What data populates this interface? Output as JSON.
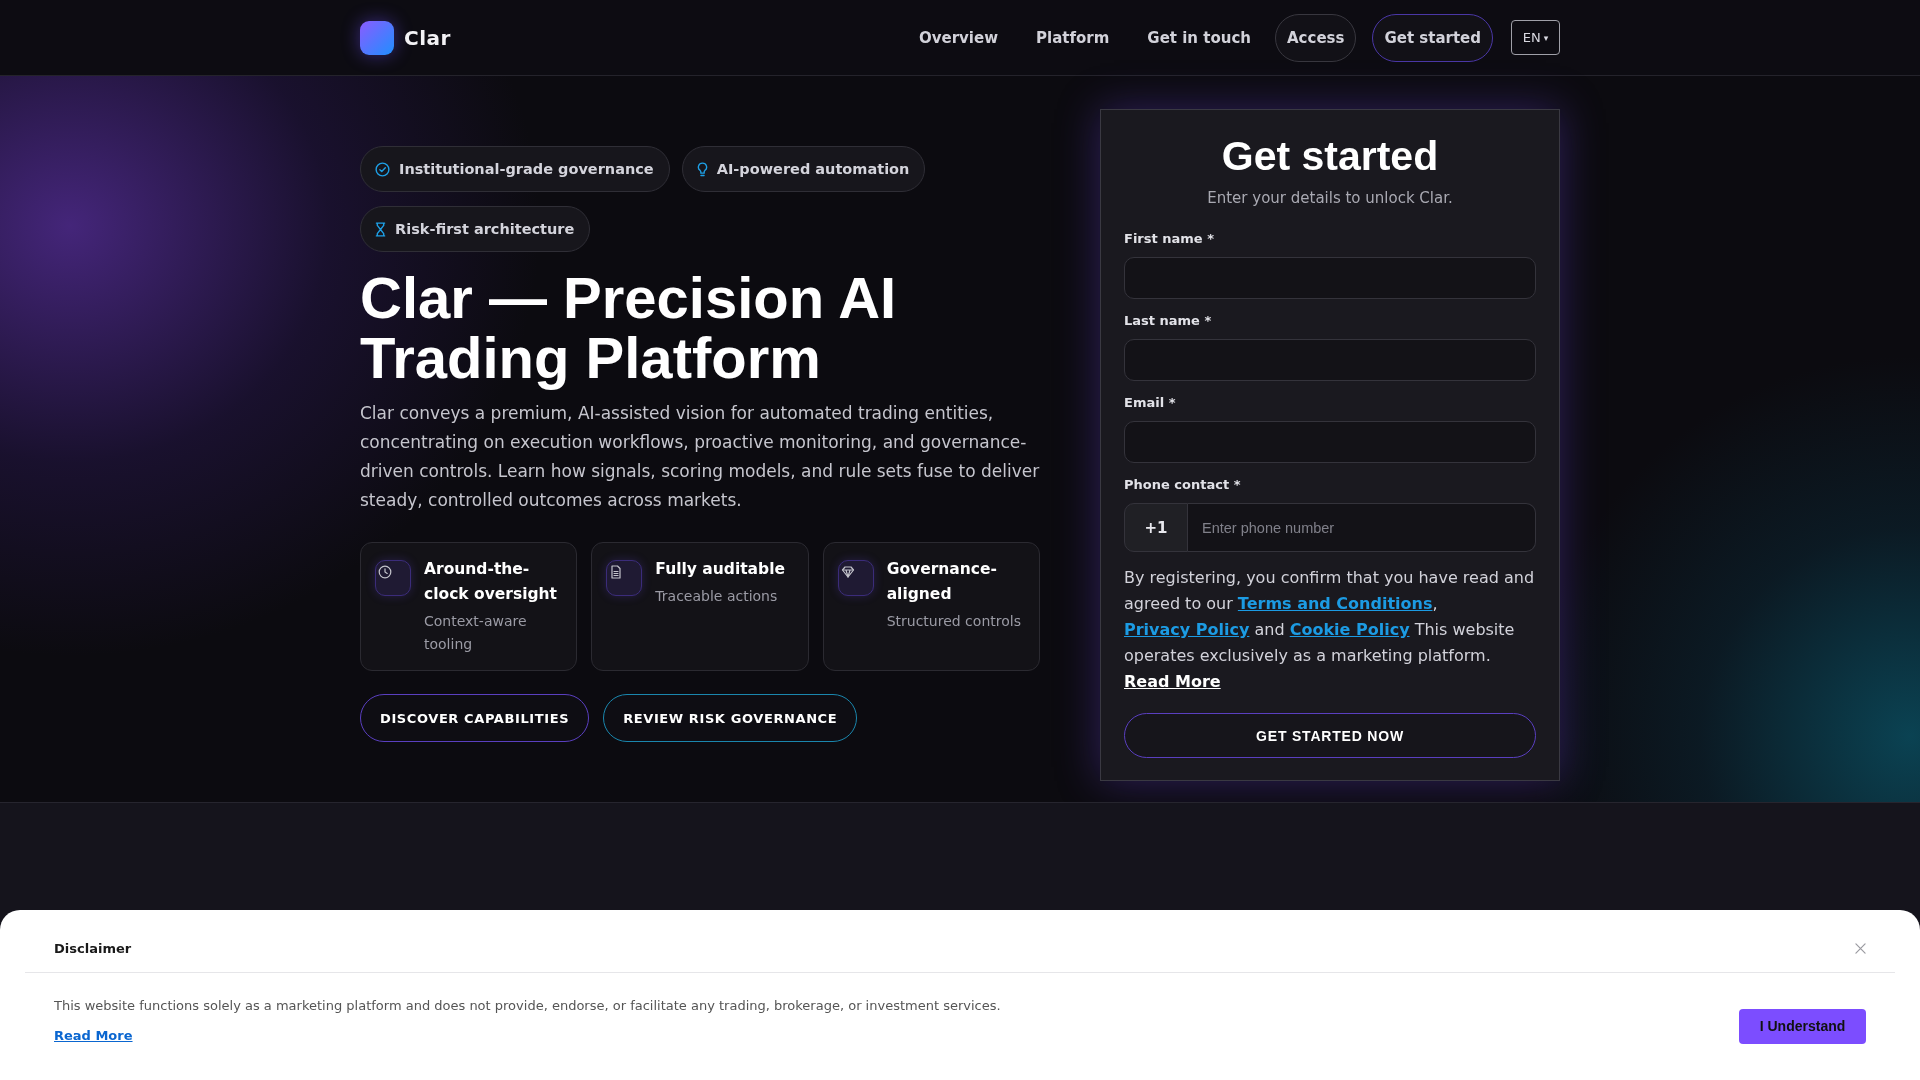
{
  "header": {
    "brand": "Clar",
    "nav": [
      {
        "label": "Overview",
        "kind": "link"
      },
      {
        "label": "Platform",
        "kind": "link"
      },
      {
        "label": "Get in touch",
        "kind": "link"
      },
      {
        "label": "Access",
        "kind": "pill"
      },
      {
        "label": "Get started",
        "kind": "accent"
      }
    ],
    "language": {
      "label": "EN",
      "caret": "▾"
    }
  },
  "hero": {
    "badges": [
      "Institutional-grade governance",
      "AI-powered automation",
      "Risk-first architecture"
    ],
    "title": "Clar — Precision AI Trading Platform",
    "intro": "Clar conveys a premium, AI-assisted vision for automated trading entities, concentrating on execution workflows, proactive monitoring, and governance-driven controls. Learn how signals, scoring models, and rule sets fuse to deliver steady, controlled outcomes across markets.",
    "features": [
      {
        "title": "Around-the-clock oversight",
        "subtitle": "Context-aware tooling"
      },
      {
        "title": "Fully auditable",
        "subtitle": "Traceable actions"
      },
      {
        "title": "Governance-aligned",
        "subtitle": "Structured controls"
      }
    ],
    "actions": [
      {
        "label": "DISCOVER CAPABILITIES",
        "kind": "primary"
      },
      {
        "label": "REVIEW RISK GOVERNANCE",
        "kind": "secondary"
      }
    ]
  },
  "signup": {
    "title": "Get started",
    "subtitle": "Enter your details to unlock Clar.",
    "fields": [
      {
        "label": "First name *",
        "kind": "text"
      },
      {
        "label": "Last name *",
        "kind": "text"
      },
      {
        "label": "Email *",
        "kind": "text"
      },
      {
        "label": "Phone contact *",
        "kind": "phone",
        "prefix": "+1",
        "placeholder": "Enter phone number"
      }
    ],
    "consent": [
      {
        "text": "By registering, you confirm that you have read and agreed to our ",
        "kind": "text"
      },
      {
        "text": "Terms and Conditions",
        "kind": "link"
      },
      {
        "text": ", ",
        "kind": "text"
      },
      {
        "text": "Privacy Policy",
        "kind": "link"
      },
      {
        "text": " and ",
        "kind": "text"
      },
      {
        "text": "Cookie Policy",
        "kind": "link"
      },
      {
        "text": " This website operates exclusively as a marketing platform. ",
        "kind": "text"
      },
      {
        "text": "Read More",
        "kind": "more"
      }
    ],
    "submit": "GET STARTED NOW"
  },
  "disclaimer": {
    "title": "Disclaimer",
    "text": "This website functions solely as a marketing platform and does not provide, endorse, or facilitate any trading, brokerage, or investment services.",
    "link": "Read More",
    "button": "I Understand"
  }
}
